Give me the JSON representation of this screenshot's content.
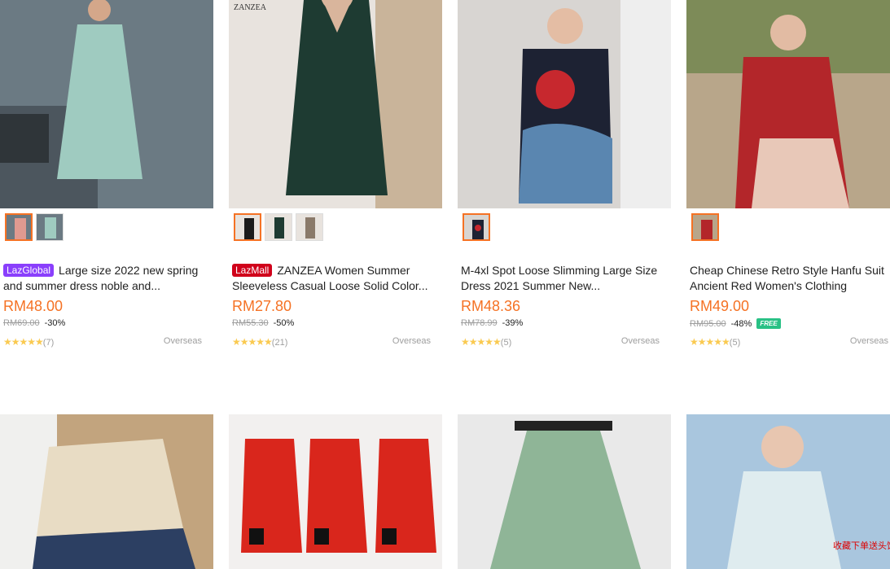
{
  "products": [
    {
      "badge": "LazGlobal",
      "badge_type": "global",
      "title": "Large size 2022 new spring and summer dress noble and...",
      "price": "RM48.00",
      "original_price": "RM69.00",
      "discount": "-30%",
      "stars": "★★★★★",
      "reviews": "(7)",
      "location": "Overseas",
      "free_shipping": "",
      "bg": "#6b7a83",
      "fg": "#9fcbc0",
      "thumbs": 2
    },
    {
      "badge": "LazMall",
      "badge_type": "mall",
      "title": "ZANZEA Women Summer Sleeveless Casual Loose Solid Color...",
      "price": "RM27.80",
      "original_price": "RM55.30",
      "discount": "-50%",
      "stars": "★★★★★",
      "reviews": "(21)",
      "location": "Overseas",
      "free_shipping": "",
      "bg": "#e8e3de",
      "fg": "#1e3b32",
      "thumbs": 3
    },
    {
      "badge": "",
      "badge_type": "",
      "title": "M-4xl Spot Loose Slimming Large Size Dress 2021 Summer New...",
      "price": "RM48.36",
      "original_price": "RM78.99",
      "discount": "-39%",
      "stars": "★★★★★",
      "reviews": "(5)",
      "location": "Overseas",
      "free_shipping": "",
      "bg": "#d8d5d2",
      "fg": "#1d2233",
      "thumbs": 1
    },
    {
      "badge": "",
      "badge_type": "",
      "title": "Cheap Chinese Retro Style Hanfu Suit Ancient Red Women's Clothing",
      "price": "RM49.00",
      "original_price": "RM95.00",
      "discount": "-48%",
      "stars": "★★★★★",
      "reviews": "(5)",
      "location": "Overseas",
      "free_shipping": "FREE",
      "bg": "#b8a68a",
      "fg": "#b3262a",
      "thumbs": 1
    }
  ],
  "row2": [
    {
      "bg": "#c2a47e",
      "fg": "#e8dcc4"
    },
    {
      "bg": "#f2f0ef",
      "fg": "#d9261c"
    },
    {
      "bg": "#e9e9e9",
      "fg": "#8fb597"
    },
    {
      "bg": "#a9c6de",
      "fg": "#dfecef"
    }
  ],
  "watermark": "收藏下单送头饰"
}
